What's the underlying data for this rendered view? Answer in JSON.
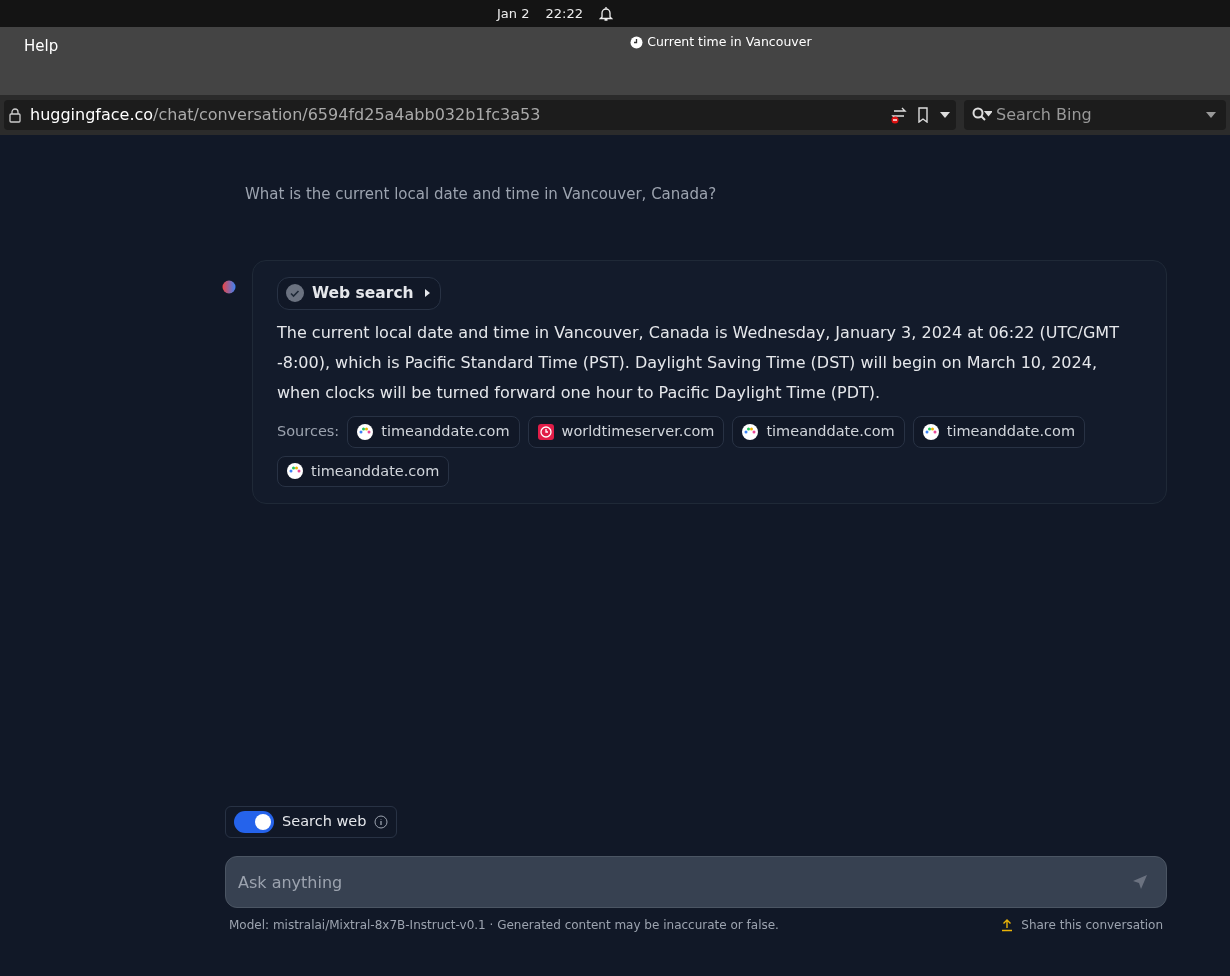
{
  "system_bar": {
    "date": "Jan 2",
    "time": "22:22"
  },
  "window": {
    "menu": "Help",
    "title": "Current time in Vancouver"
  },
  "address_bar": {
    "host": "huggingface.co",
    "path": "/chat/conversation/6594fd25a4abb032b1fc3a53",
    "search_placeholder": "Search Bing"
  },
  "user_message": "What is the current local date and time in Vancouver, Canada?",
  "assistant_message": {
    "tool": {
      "label": "Web search",
      "done": true
    },
    "text": "The current local date and time in Vancouver, Canada is Wednesday, January 3, 2024 at 06:22 (UTC/GMT -8:00), which is Pacific Standard Time (PST). Daylight Saving Time (DST) will begin on March 10, 2024, when clocks will be turned forward one hour to Pacific Daylight Time (PDT).",
    "sources_label": "Sources:",
    "sources": [
      {
        "label": "timeanddate.com",
        "kind": "dots"
      },
      {
        "label": "worldtimeserver.com",
        "kind": "clock"
      },
      {
        "label": "timeanddate.com",
        "kind": "dots"
      },
      {
        "label": "timeanddate.com",
        "kind": "dots"
      },
      {
        "label": "timeanddate.com",
        "kind": "dots"
      }
    ]
  },
  "search_web": {
    "label": "Search web",
    "on": true
  },
  "input": {
    "placeholder": "Ask anything"
  },
  "footer": {
    "model": "Model: mistralai/Mixtral-8x7B-Instruct-v0.1 · Generated content may be inaccurate or false.",
    "share": "Share this conversation"
  }
}
